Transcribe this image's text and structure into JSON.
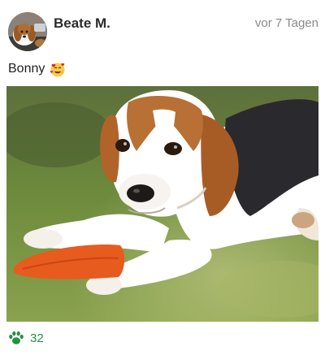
{
  "post": {
    "author": "Beate M.",
    "time": "vor 7 Tagen",
    "caption": "Bonny",
    "caption_emoji": "smiling-face-with-hearts-icon",
    "likes": "32"
  },
  "colors": {
    "like_green": "#24913e",
    "author_text": "#2b2b2b",
    "time_text": "#8a8a8a"
  }
}
